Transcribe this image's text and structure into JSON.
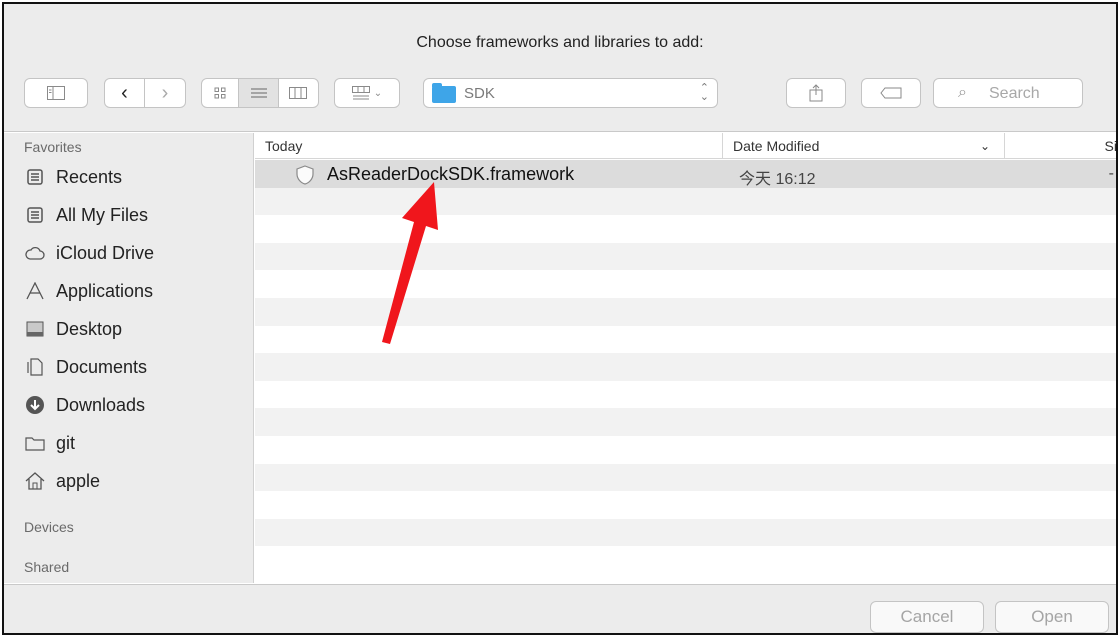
{
  "window": {
    "title": "Choose frameworks and libraries to add:"
  },
  "toolbar": {
    "path_folder": "SDK",
    "search_placeholder": "Search"
  },
  "sidebar": {
    "favorites_header": "Favorites",
    "items": [
      {
        "label": "Recents",
        "icon": "recents-icon"
      },
      {
        "label": "All My Files",
        "icon": "all-files-icon"
      },
      {
        "label": "iCloud Drive",
        "icon": "cloud-icon"
      },
      {
        "label": "Applications",
        "icon": "applications-icon"
      },
      {
        "label": "Desktop",
        "icon": "desktop-icon"
      },
      {
        "label": "Documents",
        "icon": "documents-icon"
      },
      {
        "label": "Downloads",
        "icon": "downloads-icon"
      },
      {
        "label": "git",
        "icon": "folder-icon"
      },
      {
        "label": "apple",
        "icon": "home-icon"
      }
    ],
    "devices_header": "Devices",
    "shared_header": "Shared"
  },
  "filelist": {
    "columns": {
      "name": "Today",
      "date": "Date Modified",
      "size": "Siz"
    },
    "files": [
      {
        "name": "AsReaderDockSDK.framework",
        "date": "今天 16:12",
        "size": "-"
      }
    ]
  },
  "footer": {
    "cancel_label": "Cancel",
    "open_label": "Open"
  },
  "colors": {
    "accent_folder": "#3ea5e8",
    "annotation_arrow": "#f0161c"
  }
}
